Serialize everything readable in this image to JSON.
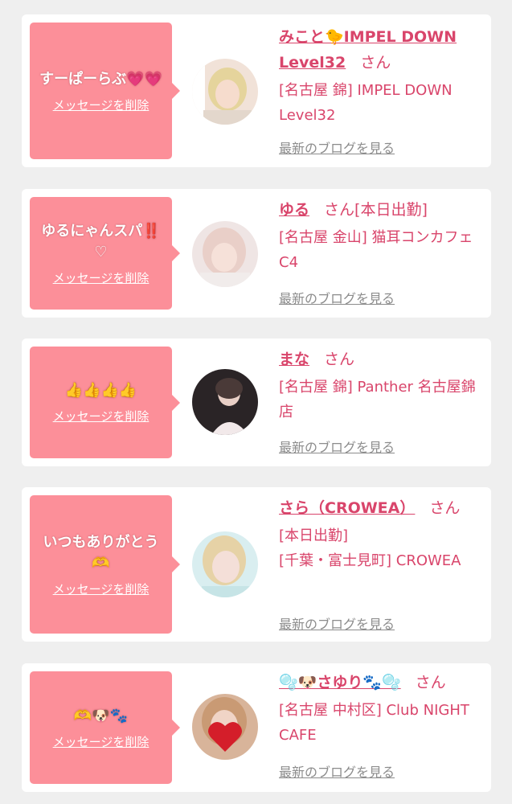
{
  "colors": {
    "accent": "#d9456b",
    "bubble": "#fc8f99",
    "link": "#8c8c8c",
    "background": "#efefef"
  },
  "cards": [
    {
      "message": "すーぱーらぶ💗💗",
      "delete_label": "メッセージを削除",
      "name": "みこと🐤IMPEL DOWN Level32",
      "honorific": "さん",
      "status": "",
      "shop": "[名古屋 錦] IMPEL DOWN Level32",
      "blog_label": "最新のブログを見る",
      "avatar_icon": "profile-photo"
    },
    {
      "message": "ゆるにゃんスパ‼️♡",
      "delete_label": "メッセージを削除",
      "name": "ゆる",
      "honorific": "さん",
      "status": "[本日出勤]",
      "shop": "[名古屋 金山] 猫耳コンカフェ C4",
      "blog_label": "最新のブログを見る",
      "avatar_icon": "profile-photo"
    },
    {
      "message": "👍👍👍👍",
      "delete_label": "メッセージを削除",
      "name": "まな",
      "honorific": "さん",
      "status": "",
      "shop": "[名古屋 錦] Panther 名古屋錦店",
      "blog_label": "最新のブログを見る",
      "avatar_icon": "profile-photo"
    },
    {
      "message": "いつもありがとう🫶",
      "delete_label": "メッセージを削除",
      "name": "さら（CROWEA）",
      "honorific": "さん",
      "status": "[本日出勤]",
      "shop": "[千葉・富士見町] CROWEA",
      "blog_label": "最新のブログを見る",
      "avatar_icon": "profile-photo"
    },
    {
      "message": "🫶🐶🐾",
      "delete_label": "メッセージを削除",
      "name": "🫧🐶さゆり🐾🫧",
      "honorific": "さん",
      "status": "",
      "shop": "[名古屋 中村区] Club NIGHT CAFE",
      "blog_label": "最新のブログを見る",
      "avatar_icon": "heart-photo"
    }
  ]
}
